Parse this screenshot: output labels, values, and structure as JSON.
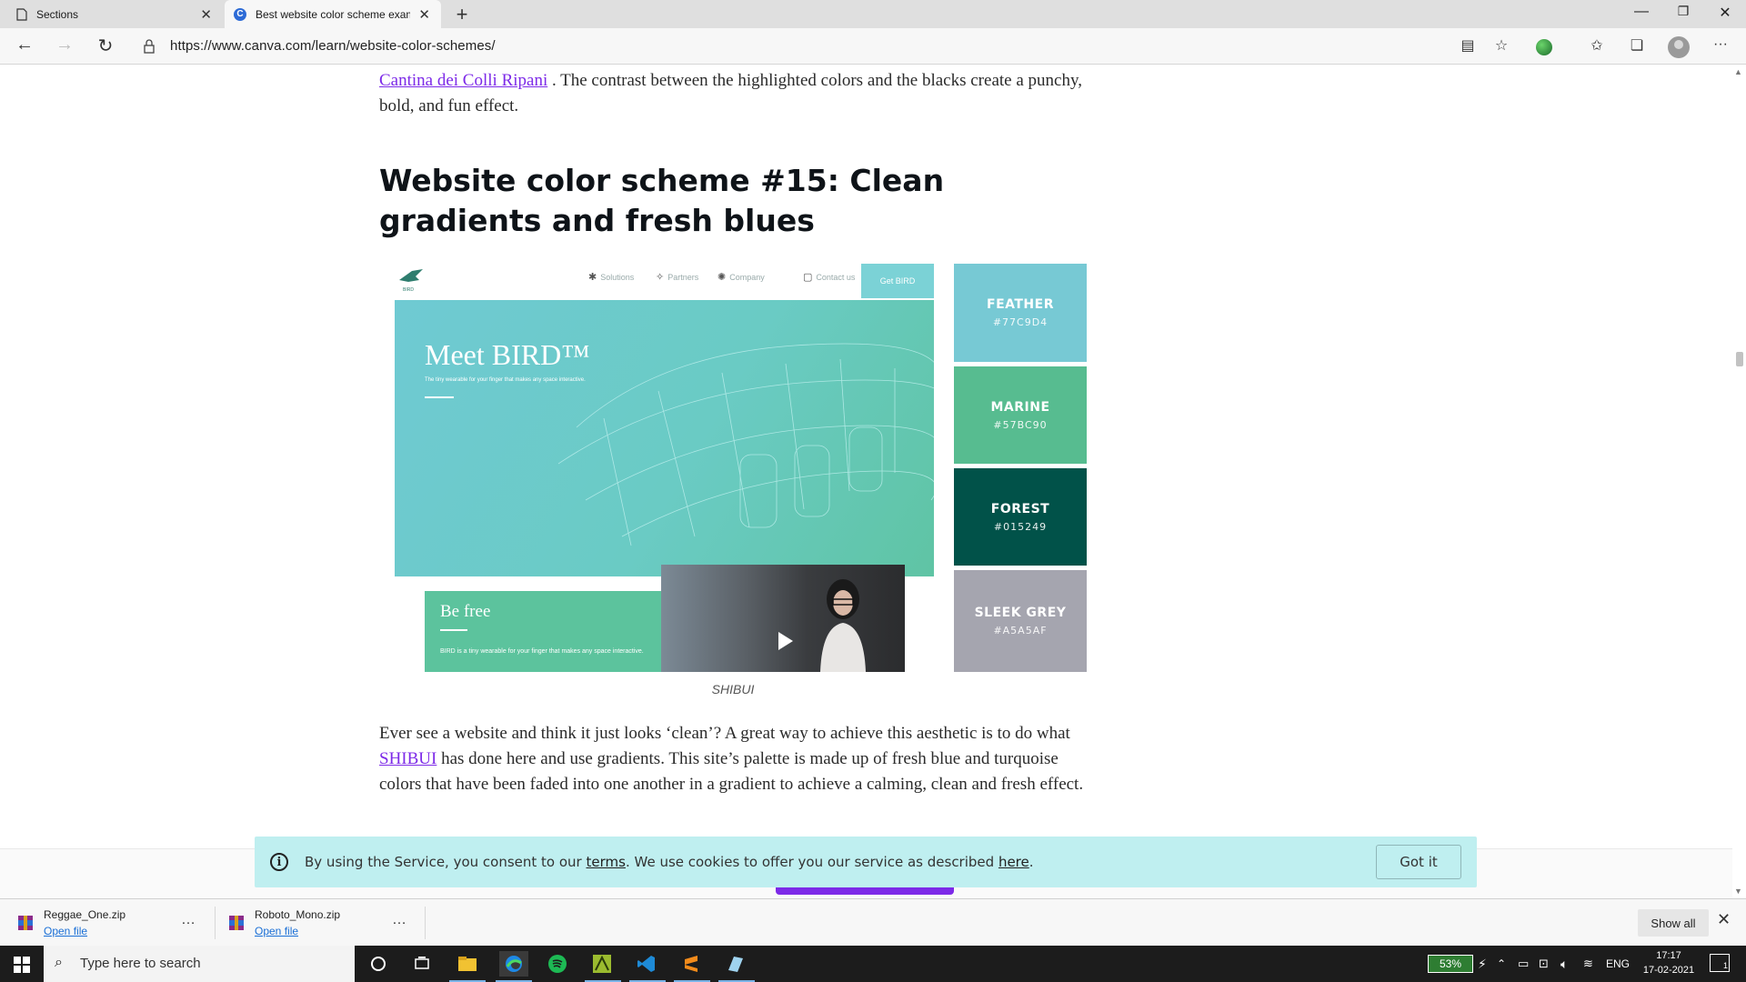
{
  "browser": {
    "tabs": [
      {
        "title": "Sections",
        "close": "✕"
      },
      {
        "title": "Best website color scheme exam",
        "close": "✕"
      }
    ],
    "new_tab": "+",
    "url": "https://www.canva.com/learn/website-color-schemes/",
    "window": {
      "minimize": "—",
      "restore": "❐",
      "close": "✕"
    }
  },
  "article": {
    "intro_link": "Cantina dei Colli Ripani",
    "intro_text": " . The contrast between the highlighted colors and the blacks create a punchy, bold, and fun effect.",
    "heading": "Website color scheme #15: Clean gradients and fresh blues",
    "figure": {
      "hero_title": "Meet BIRD™",
      "hero_sub": "The tiny wearable for your finger that makes any space interactive.",
      "nav": [
        "Solutions",
        "Partners",
        "Company",
        "Contact us"
      ],
      "get_bird": "Get BIRD",
      "befree_title": "Be free",
      "befree_sub": "BIRD is a tiny wearable for your finger that makes any space interactive.",
      "swatches": [
        {
          "name": "FEATHER",
          "hex": "#77C9D4",
          "color": "#77C9D4"
        },
        {
          "name": "MARINE",
          "hex": "#57BC90",
          "color": "#57BC90"
        },
        {
          "name": "FOREST",
          "hex": "#015249",
          "color": "#015249"
        },
        {
          "name": "SLEEK GREY",
          "hex": "#A5A5AF",
          "color": "#A5A5AF"
        }
      ]
    },
    "caption": "SHIBUI",
    "body_pre": "Ever see a website and think it just looks ‘clean’? A great way to achieve this aesthetic is to do what ",
    "body_link": "SHIBUI",
    "body_post": " has done here and use gradients. This site’s palette is made up of fresh blue and turquoise colors that have been faded into one another in a gradient to achieve a calming, clean and fresh effect."
  },
  "cookie": {
    "text_pre": "By using the Service, you consent to our ",
    "terms": "terms",
    "text_mid": ". We use cookies to offer you our service as described ",
    "here": "here",
    "text_post": ".",
    "button": "Got it"
  },
  "downloads": {
    "items": [
      {
        "name": "Reggae_One.zip",
        "action": "Open file"
      },
      {
        "name": "Roboto_Mono.zip",
        "action": "Open file"
      }
    ],
    "more": "…",
    "show_all": "Show all",
    "close": "✕"
  },
  "taskbar": {
    "search_placeholder": "Type here to search",
    "battery": "53%",
    "lang": "ENG",
    "time": "17:17",
    "date": "17-02-2021",
    "notifications": "1"
  },
  "colors": {
    "accent_link": "#7d2ae8",
    "cookie_bg": "#bfeff0"
  }
}
